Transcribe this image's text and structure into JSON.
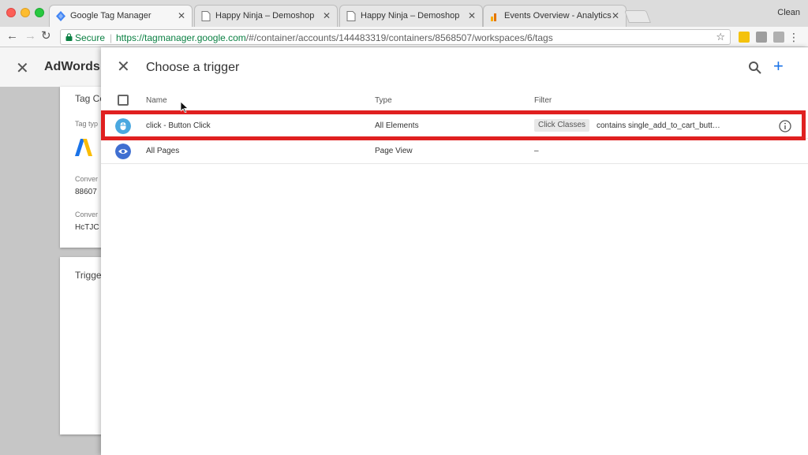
{
  "browser": {
    "tabs": [
      {
        "label": "Google Tag Manager",
        "active": true,
        "icon": "gtm-diamond-icon"
      },
      {
        "label": "Happy Ninja – Demoshop",
        "active": false,
        "icon": "page-icon"
      },
      {
        "label": "Happy Ninja – Demoshop",
        "active": false,
        "icon": "page-icon"
      },
      {
        "label": "Events Overview - Analytics",
        "active": false,
        "icon": "analytics-icon"
      }
    ],
    "profile": "Clean",
    "secure_label": "Secure",
    "url_scheme": "https://",
    "url_host": "tagmanager.google.com",
    "url_path": "/#/container/accounts/144483319/containers/8568507/workspaces/6/tags",
    "colors": {
      "secure": "#0b8043"
    }
  },
  "background_page": {
    "title": "AdWords",
    "card1": {
      "title": "Tag Co",
      "tag_type_label": "Tag typ",
      "conversion_id_label": "Conver",
      "conversion_id_value": "88607",
      "conversion_label_label": "Conver",
      "conversion_label_value": "HcTJC"
    },
    "card2": {
      "title": "Trigge"
    }
  },
  "trigger_panel": {
    "title": "Choose a trigger",
    "columns": {
      "name": "Name",
      "type": "Type",
      "filter": "Filter"
    },
    "rows": [
      {
        "name": "click - Button Click",
        "type": "All Elements",
        "filter_chip": "Click Classes",
        "filter_condition": "contains single_add_to_cart_butt…",
        "icon": "click-trigger-icon",
        "highlighted": true
      },
      {
        "name": "All Pages",
        "type": "Page View",
        "filter_text": "–",
        "icon": "pageview-eye-icon",
        "highlighted": false
      }
    ],
    "colors": {
      "accent": "#1a73e8",
      "highlight": "#e02020",
      "click_icon": "#4aa8e0",
      "pageview_icon": "#3f6fd1"
    }
  }
}
